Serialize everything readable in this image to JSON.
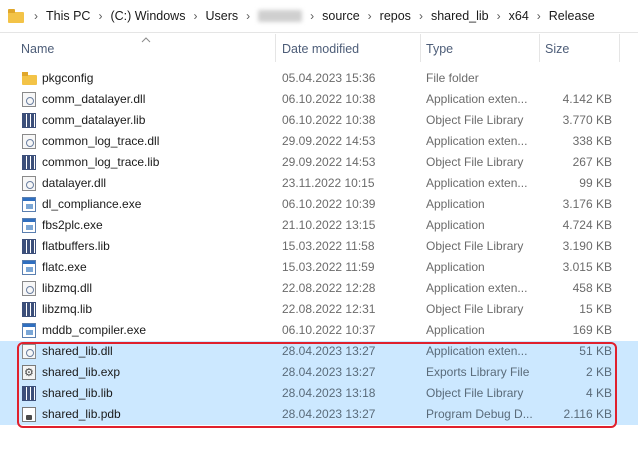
{
  "breadcrumb": {
    "items": [
      "This PC",
      "(C:) Windows",
      "Users",
      "",
      "source",
      "repos",
      "shared_lib",
      "x64",
      "Release"
    ],
    "separator": "›"
  },
  "columns": {
    "name": "Name",
    "date": "Date modified",
    "type": "Type",
    "size": "Size"
  },
  "files": [
    {
      "name": "pkgconfig",
      "date": "05.04.2023 15:36",
      "type": "File folder",
      "size": "",
      "icon": "folder-icon",
      "selected": false
    },
    {
      "name": "comm_datalayer.dll",
      "date": "06.10.2022 10:38",
      "type": "Application exten...",
      "size": "4.142 KB",
      "icon": "dll-file-icon",
      "selected": false
    },
    {
      "name": "comm_datalayer.lib",
      "date": "06.10.2022 10:38",
      "type": "Object File Library",
      "size": "3.770 KB",
      "icon": "lib-file-icon",
      "selected": false
    },
    {
      "name": "common_log_trace.dll",
      "date": "29.09.2022 14:53",
      "type": "Application exten...",
      "size": "338 KB",
      "icon": "dll-file-icon",
      "selected": false
    },
    {
      "name": "common_log_trace.lib",
      "date": "29.09.2022 14:53",
      "type": "Object File Library",
      "size": "267 KB",
      "icon": "lib-file-icon",
      "selected": false
    },
    {
      "name": "datalayer.dll",
      "date": "23.11.2022 10:15",
      "type": "Application exten...",
      "size": "99 KB",
      "icon": "dll-file-icon",
      "selected": false
    },
    {
      "name": "dl_compliance.exe",
      "date": "06.10.2022 10:39",
      "type": "Application",
      "size": "3.176 KB",
      "icon": "exe-file-icon",
      "selected": false
    },
    {
      "name": "fbs2plc.exe",
      "date": "21.10.2022 13:15",
      "type": "Application",
      "size": "4.724 KB",
      "icon": "exe-file-icon",
      "selected": false
    },
    {
      "name": "flatbuffers.lib",
      "date": "15.03.2022 11:58",
      "type": "Object File Library",
      "size": "3.190 KB",
      "icon": "lib-file-icon",
      "selected": false
    },
    {
      "name": "flatc.exe",
      "date": "15.03.2022 11:59",
      "type": "Application",
      "size": "3.015 KB",
      "icon": "exe-file-icon",
      "selected": false
    },
    {
      "name": "libzmq.dll",
      "date": "22.08.2022 12:28",
      "type": "Application exten...",
      "size": "458 KB",
      "icon": "dll-file-icon",
      "selected": false
    },
    {
      "name": "libzmq.lib",
      "date": "22.08.2022 12:31",
      "type": "Object File Library",
      "size": "15 KB",
      "icon": "lib-file-icon",
      "selected": false
    },
    {
      "name": "mddb_compiler.exe",
      "date": "06.10.2022 10:37",
      "type": "Application",
      "size": "169 KB",
      "icon": "exe-file-icon",
      "selected": false
    },
    {
      "name": "shared_lib.dll",
      "date": "28.04.2023 13:27",
      "type": "Application exten...",
      "size": "51 KB",
      "icon": "dll-file-icon",
      "selected": true
    },
    {
      "name": "shared_lib.exp",
      "date": "28.04.2023 13:27",
      "type": "Exports Library File",
      "size": "2 KB",
      "icon": "exp-file-icon",
      "selected": true
    },
    {
      "name": "shared_lib.lib",
      "date": "28.04.2023 13:18",
      "type": "Object File Library",
      "size": "4 KB",
      "icon": "lib-file-icon",
      "selected": true
    },
    {
      "name": "shared_lib.pdb",
      "date": "28.04.2023 13:27",
      "type": "Program Debug D...",
      "size": "2.116 KB",
      "icon": "pdb-file-icon",
      "selected": true
    }
  ],
  "colors": {
    "selection": "#cce8ff",
    "highlight_border": "#e0202d",
    "header_text": "#4d5d78"
  }
}
